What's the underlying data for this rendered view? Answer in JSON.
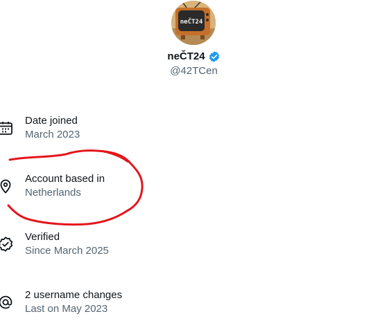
{
  "profile": {
    "display_name": "neČT24",
    "handle": "@42TCen",
    "avatar_text": "neČT24",
    "verified": true
  },
  "details": [
    {
      "icon": "calendar-icon",
      "title": "Date joined",
      "subtitle": "March 2023"
    },
    {
      "icon": "location-pin-icon",
      "title": "Account based in",
      "subtitle": "Netherlands"
    },
    {
      "icon": "verified-check-icon",
      "title": "Verified",
      "subtitle": "Since March 2025"
    },
    {
      "icon": "at-sign-icon",
      "title": "2 username changes",
      "subtitle": "Last on May 2023"
    }
  ],
  "colors": {
    "text_primary": "#0f1419",
    "text_secondary": "#536471",
    "verified_blue": "#1d9bf0",
    "annotation_red": "#e5141b"
  }
}
